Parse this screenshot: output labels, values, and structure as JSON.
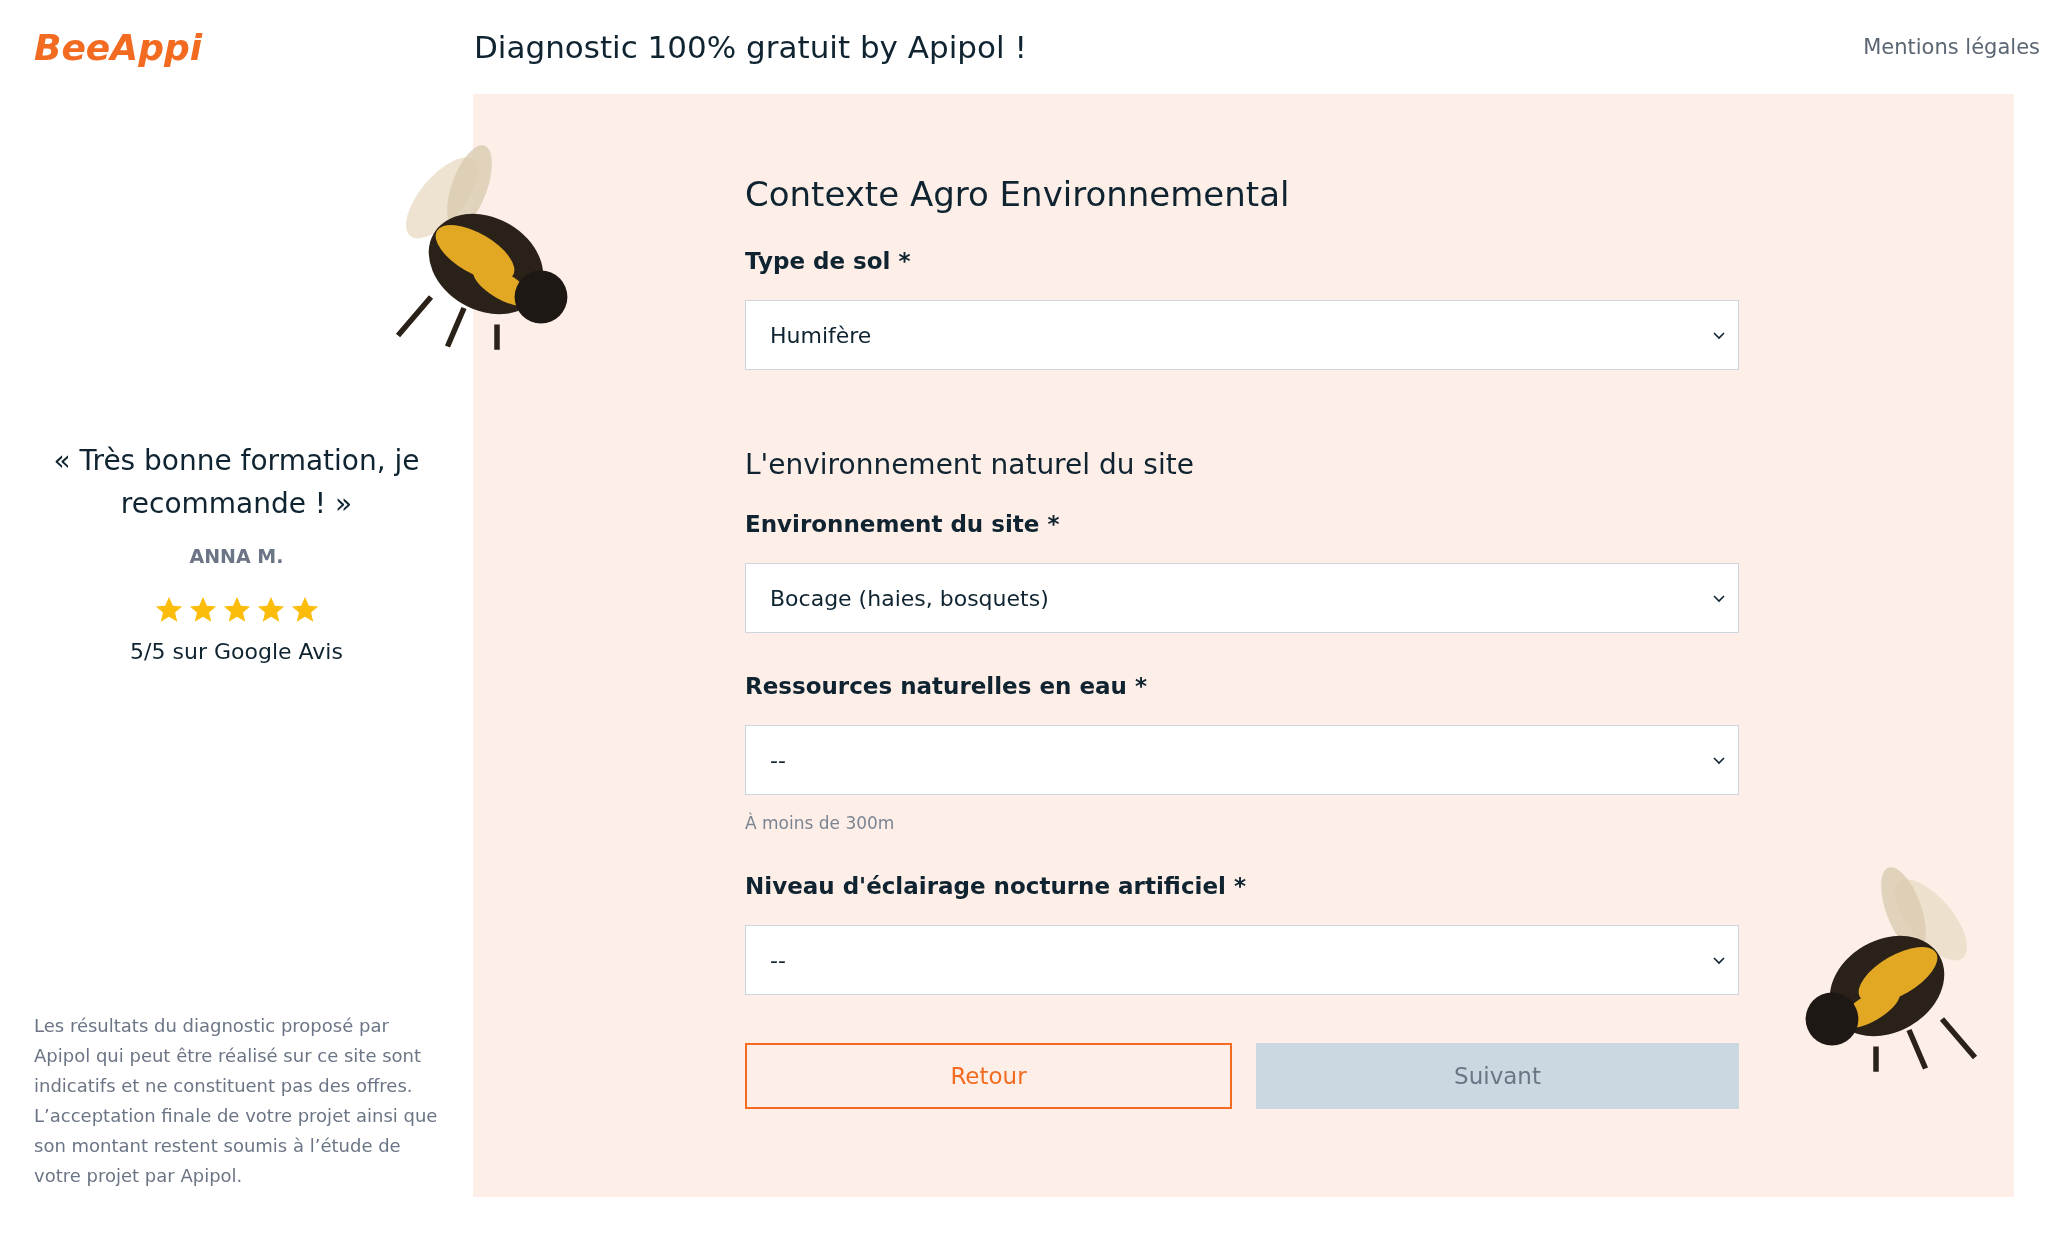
{
  "header": {
    "logo": "BeeAppi",
    "title": "Diagnostic 100% gratuit by Apipol !",
    "link": "Mentions légales"
  },
  "testimonial": {
    "quote": "« Très bonne formation, je recommande ! »",
    "author": "ANNA M.",
    "stars": 5,
    "rating": "5/5 sur Google Avis"
  },
  "disclaimer": "Les résultats du diagnostic proposé par Apipol qui peut être réalisé sur ce site sont indicatifs et ne constituent pas des offres. L’acceptation finale de votre projet ainsi que son montant restent soumis à l’étude de votre projet par Apipol.",
  "form": {
    "blocks": [
      {
        "kind": "title",
        "text": "Contexte Agro Environnemental"
      },
      {
        "kind": "field",
        "label": "Type de sol *",
        "value": "Humifère"
      },
      {
        "kind": "section",
        "text": "L'environnement naturel du site"
      },
      {
        "kind": "field",
        "label": "Environnement du site *",
        "value": "Bocage (haies, bosquets)"
      },
      {
        "kind": "field",
        "label": "Ressources naturelles en eau *",
        "value": "--",
        "hint": "À moins de 300m"
      },
      {
        "kind": "field",
        "label": "Niveau d'éclairage nocturne artificiel *",
        "value": "--"
      }
    ],
    "buttons": [
      {
        "label": "Retour",
        "kind": "outline",
        "disabled": false
      },
      {
        "label": "Suivant",
        "kind": "primary",
        "disabled": true
      }
    ]
  }
}
